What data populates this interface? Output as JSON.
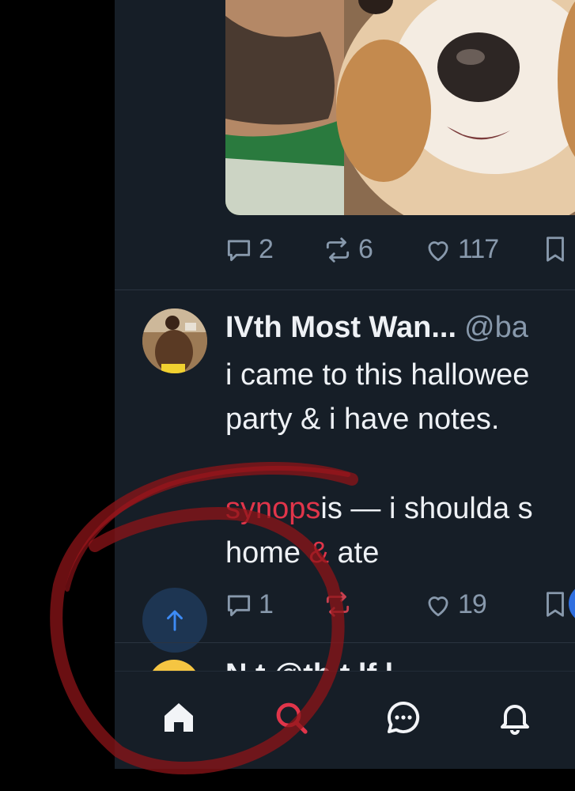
{
  "post1": {
    "image_alt": "man with beard cuddling a corgi",
    "stats": {
      "replies": "2",
      "reposts": "6",
      "likes": "117"
    }
  },
  "post2": {
    "author_name": "IVth Most Wan...",
    "author_handle": "@ba",
    "text_line1": "i came to this hallowee",
    "text_line2": "party & i have notes.",
    "text_line3_part1": "synops",
    "text_line3_part2": "is — i shoulda s",
    "text_line4_part1": "home ",
    "text_line4_amp": "&",
    "text_line4_part2": " ate",
    "stats": {
      "replies": "1",
      "reposts": "",
      "likes": "19"
    }
  },
  "post3_peek": {
    "text": "N t @th t lf l"
  },
  "bottom_nav": {
    "items": [
      {
        "name": "home",
        "icon": "home-icon"
      },
      {
        "name": "search",
        "icon": "search-icon"
      },
      {
        "name": "chat",
        "icon": "chat-bubble-icon"
      },
      {
        "name": "notifications",
        "icon": "bell-icon"
      }
    ]
  },
  "colors": {
    "background": "#161e27",
    "text": "#eef1f5",
    "muted": "#8899ac",
    "accent_red": "#e0354a",
    "scroll_top_bg": "#1d3552",
    "scroll_top_arrow": "#3d8bf5"
  }
}
